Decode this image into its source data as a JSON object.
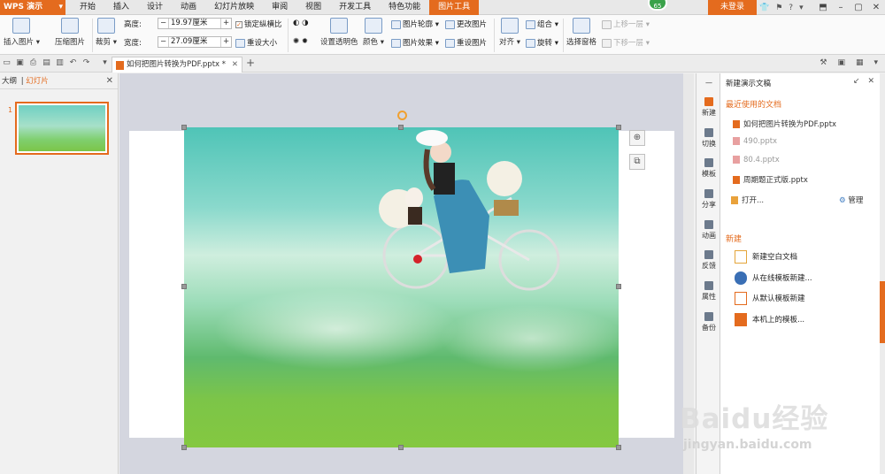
{
  "app": {
    "logo": "WPS 演示",
    "badge": "65",
    "login": "未登录"
  },
  "tabs": [
    "开始",
    "插入",
    "设计",
    "动画",
    "幻灯片放映",
    "审阅",
    "视图",
    "开发工具",
    "特色功能",
    "图片工具"
  ],
  "active_tab": "图片工具",
  "ribbon": {
    "insert_picture": "插入图片",
    "compress_picture": "压缩图片",
    "crop": "裁剪",
    "height_label": "高度:",
    "height_value": "19.97厘米",
    "width_label": "宽度:",
    "width_value": "27.09厘米",
    "lock_ratio": "锁定纵横比",
    "reset_size": "重设大小",
    "set_transparent": "设置透明色",
    "color": "颜色",
    "picture_outline": "图片轮廓",
    "picture_effects": "图片效果",
    "change_picture": "更改图片",
    "reset_picture": "重设图片",
    "align": "对齐",
    "group": "组合",
    "rotate": "旋转",
    "selection_pane": "选择窗格",
    "bring_forward": "上移一层",
    "send_backward": "下移一层"
  },
  "document": {
    "tab_title": "如何把图片转换为PDF.pptx *"
  },
  "left_panel": {
    "tab_outline": "大纲",
    "tab_slides": "幻灯片",
    "slide_number": "1"
  },
  "task_pane": {
    "title": "新建演示文稿",
    "recent_title": "最近使用的文档",
    "recent_docs": [
      {
        "name": "如何把图片转换为PDF.pptx",
        "dim": false
      },
      {
        "name": "490.pptx",
        "dim": true
      },
      {
        "name": "80.4.pptx",
        "dim": true
      },
      {
        "name": "周期题正式版.pptx",
        "dim": false
      }
    ],
    "open": "打开...",
    "manage": "管理",
    "new_title": "新建",
    "new_items": [
      "新建空白文档",
      "从在线模板新建...",
      "从默认模板新建",
      "本机上的模板..."
    ]
  },
  "sidebar": [
    "新建",
    "切换",
    "模板",
    "分享",
    "动画",
    "反馈",
    "属性",
    "备份"
  ],
  "watermark": {
    "brand": "Baidu经验",
    "url": "jingyan.baidu.com"
  }
}
